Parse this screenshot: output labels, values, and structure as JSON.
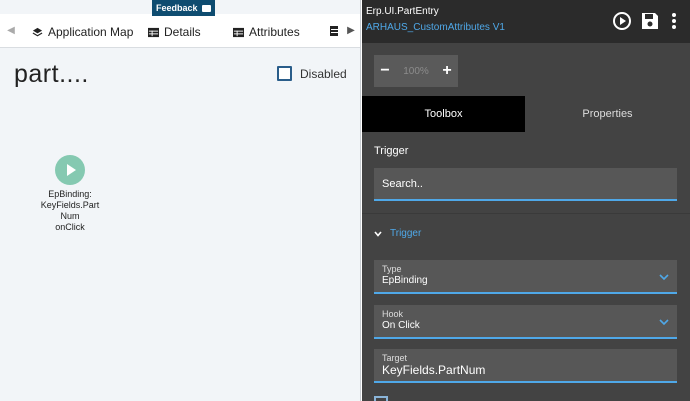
{
  "left": {
    "feedback_label": "Feedback",
    "tabs": [
      {
        "label": "Application Map",
        "icon": "layers-icon"
      },
      {
        "label": "Details",
        "icon": "grid-icon"
      },
      {
        "label": "Attributes",
        "icon": "grid-icon"
      }
    ],
    "page_title": "part....",
    "disabled_label": "Disabled",
    "node": {
      "icon": "play-icon",
      "label": "EpBinding:\nKeyFields.Part\nNum\nonClick"
    }
  },
  "right": {
    "title": "Erp.UI.PartEntry",
    "subtitle": "ARHAUS_CustomAttributes V1",
    "zoom": {
      "value": "100%",
      "minus": "−",
      "plus": "+"
    },
    "tabs": {
      "toolbox": "Toolbox",
      "properties": "Properties"
    },
    "section_label": "Trigger",
    "search_placeholder": "Search..",
    "trigger_header": "Trigger",
    "fields": {
      "type_label": "Type",
      "type_value": "EpBinding",
      "hook_label": "Hook",
      "hook_value": "On Click",
      "target_label": "Target",
      "target_value": "KeyFields.PartNum"
    }
  },
  "colors": {
    "accent": "#4fa8e8",
    "node": "#85c9b1",
    "feedback": "#0e4c70"
  }
}
